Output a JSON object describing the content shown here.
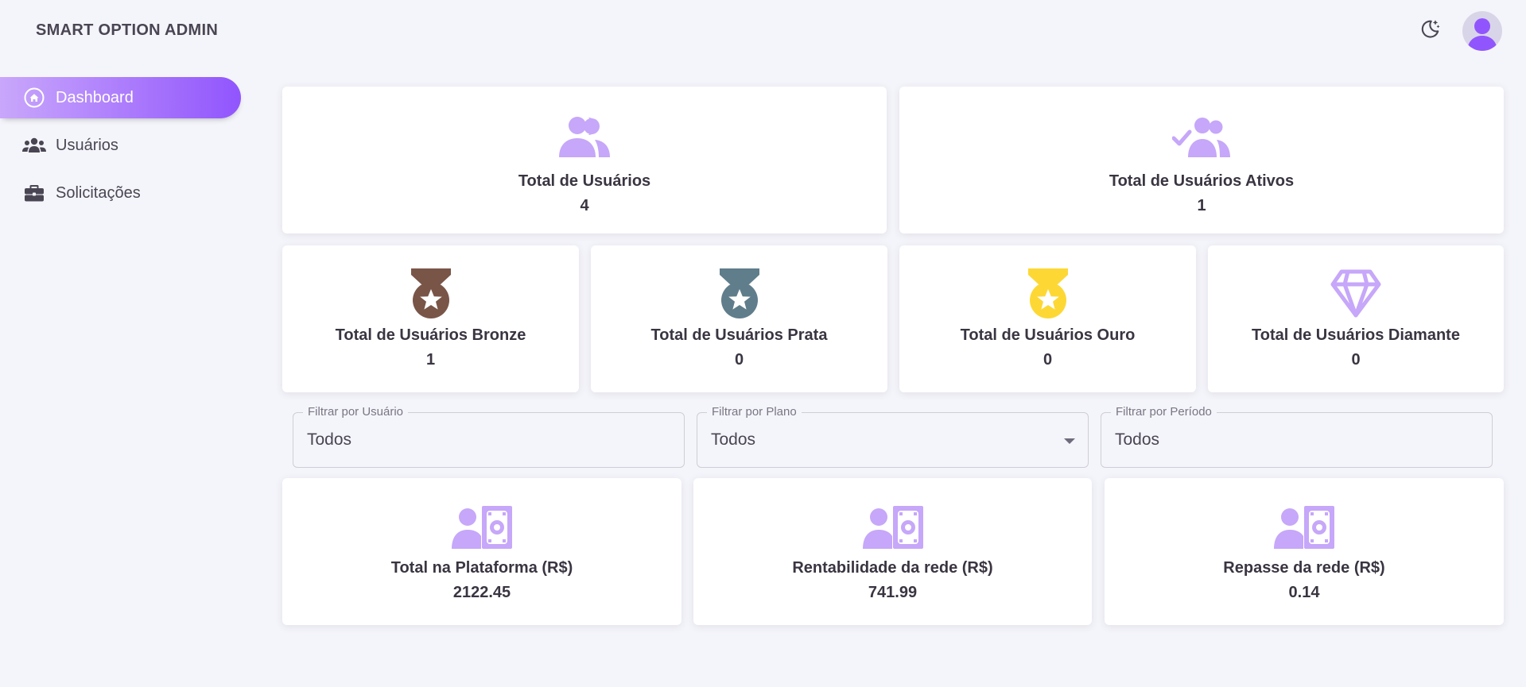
{
  "brand": "SMART OPTION ADMIN",
  "sidebar": {
    "items": [
      {
        "label": "Dashboard",
        "icon": "home-icon",
        "active": true
      },
      {
        "label": "Usuários",
        "icon": "users-icon"
      },
      {
        "label": "Solicitações",
        "icon": "briefcase-icon"
      }
    ]
  },
  "top_stats": [
    {
      "title": "Total de Usuários",
      "value": "4",
      "icon": "users-icon"
    },
    {
      "title": "Total de Usuários Ativos",
      "value": "1",
      "icon": "users-check-icon"
    }
  ],
  "tier_stats": [
    {
      "title": "Total de Usuários Bronze",
      "value": "1",
      "icon": "medal-icon",
      "color": "#795548"
    },
    {
      "title": "Total de Usuários Prata",
      "value": "0",
      "icon": "medal-icon",
      "color": "#607d8b"
    },
    {
      "title": "Total de Usuários Ouro",
      "value": "0",
      "icon": "medal-icon",
      "color": "#fdd835"
    },
    {
      "title": "Total de Usuários Diamante",
      "value": "0",
      "icon": "diamond-icon",
      "color": "#c6a7f9"
    }
  ],
  "filters": [
    {
      "label": "Filtrar por Usuário",
      "value": "Todos"
    },
    {
      "label": "Filtrar por Plano",
      "value": "Todos"
    },
    {
      "label": "Filtrar por Período",
      "value": "Todos"
    }
  ],
  "finance_stats": [
    {
      "title": "Total na Plataforma (R$)",
      "value": "2122.45",
      "icon": "user-cash-icon"
    },
    {
      "title": "Rentabilidade da rede (R$)",
      "value": "741.99",
      "icon": "user-cash-icon"
    },
    {
      "title": "Repasse da rede (R$)",
      "value": "0.14",
      "icon": "user-cash-icon"
    }
  ],
  "colors": {
    "accent": "#9155fd",
    "accent_light": "#c9a7fb",
    "icon_lavender": "#c6a7f9",
    "background": "#f4f5fa"
  }
}
